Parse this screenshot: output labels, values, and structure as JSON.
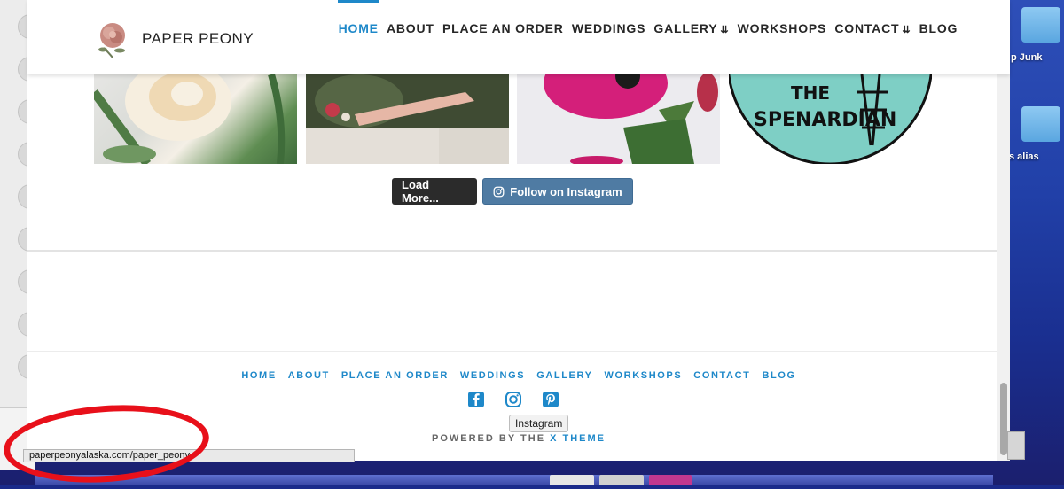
{
  "brand": {
    "name": "PAPER PEONY"
  },
  "nav": [
    {
      "label": "HOME",
      "active": true,
      "chevron": false
    },
    {
      "label": "ABOUT",
      "active": false,
      "chevron": false
    },
    {
      "label": "PLACE AN ORDER",
      "active": false,
      "chevron": false
    },
    {
      "label": "WEDDINGS",
      "active": false,
      "chevron": false
    },
    {
      "label": "GALLERY",
      "active": false,
      "chevron": true
    },
    {
      "label": "WORKSHOPS",
      "active": false,
      "chevron": false
    },
    {
      "label": "CONTACT",
      "active": false,
      "chevron": true
    },
    {
      "label": "BLOG",
      "active": false,
      "chevron": false
    }
  ],
  "instagram": {
    "spenardian_text_1": "THE",
    "spenardian_text_2": "SPENARDIAN",
    "load_more": "Load More...",
    "follow": "Follow on Instagram"
  },
  "footer": {
    "links": [
      "HOME",
      "ABOUT",
      "PLACE AN ORDER",
      "WEDDINGS",
      "GALLERY",
      "WORKSHOPS",
      "CONTACT",
      "BLOG"
    ],
    "tooltip": "Instagram",
    "powered_prefix": "POWERED BY THE ",
    "powered_accent": "X THEME"
  },
  "status_url": "paperpeonyalaska.com/paper_peony",
  "desktop": {
    "label1": "p Junk",
    "label2": "s alias"
  },
  "colors": {
    "accent": "#1e88c9",
    "ig_button": "#4f7ba3",
    "annotation": "#e8101a"
  }
}
